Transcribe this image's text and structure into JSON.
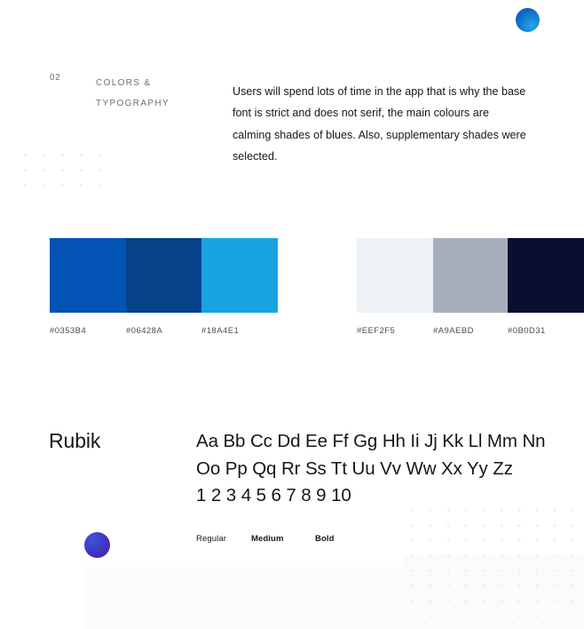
{
  "section": {
    "number": "02",
    "title_lines": [
      "COLORS &",
      "TYPOGRAPHY"
    ],
    "paragraph": "Users will spend lots of time in the app that is why the base font is strict and does not serif, the main colours are calming shades of blues. Also, supplementary shades were selected."
  },
  "palettes": [
    {
      "name": "primary-colors",
      "swatches": [
        {
          "hex": "#0353B4",
          "label": "#0353B4",
          "width": 86
        },
        {
          "hex": "#06428A",
          "label": "#06428A",
          "width": 85
        },
        {
          "hex": "#18A4E1",
          "label": "#18A4E1",
          "width": 86
        }
      ],
      "label_offsets": [
        0,
        86,
        171
      ]
    },
    {
      "name": "supplementary-colors",
      "swatches": [
        {
          "hex": "#EEF2F5",
          "label": "#EEF2F5",
          "width": 86
        },
        {
          "hex": "#A9AEBD",
          "label": "#A9AEBD",
          "width": 84
        },
        {
          "hex": "#0B0D31",
          "label": "#0B0D31",
          "width": 86
        }
      ],
      "label_offsets": [
        0,
        86,
        170
      ]
    }
  ],
  "typography": {
    "font_name": "Rubik",
    "specimen_lines": [
      "Aa Bb Cc Dd Ee Ff Gg Hh Ii Jj Kk Ll Mm Nn",
      "Oo Pp Qq Rr Ss Tt Uu Vv Ww Xx Yy Zz",
      "1 2 3 4 5 6 7 8 9 10"
    ],
    "weights": [
      {
        "label": "Regular",
        "offset": 0
      },
      {
        "label": "Medium",
        "offset": 62
      },
      {
        "label": "Bold",
        "offset": 134
      }
    ]
  },
  "decor": {
    "sphere_blue_color": "#1385D6",
    "sphere_purple_color": "#4A23B8",
    "dot_color": "#ECEEF2"
  }
}
